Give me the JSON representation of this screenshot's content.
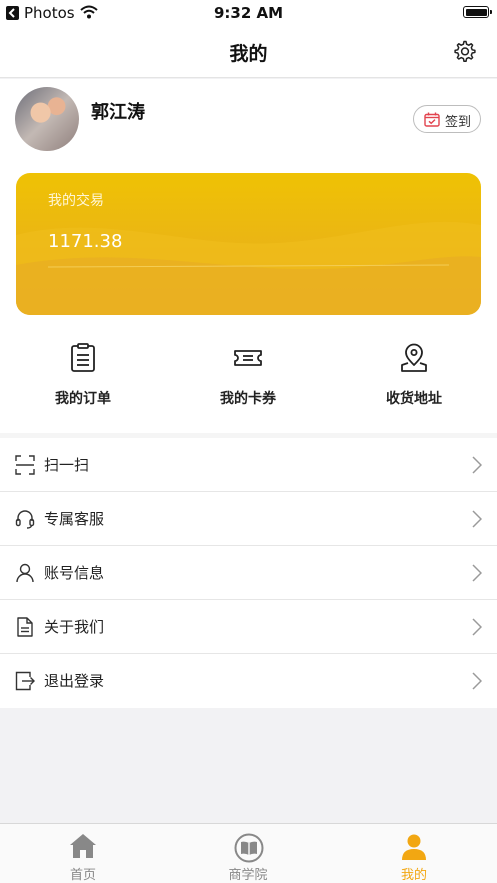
{
  "status_bar": {
    "app": "Photos",
    "time": "9:32 AM"
  },
  "nav": {
    "title": "我的",
    "settings_icon": "gear-icon"
  },
  "profile": {
    "name": "郭江涛",
    "checkin_label": "签到"
  },
  "card": {
    "label": "我的交易",
    "value": "1171.38"
  },
  "shortcuts": [
    {
      "label": "我的订单",
      "icon": "order-icon"
    },
    {
      "label": "我的卡券",
      "icon": "coupon-icon"
    },
    {
      "label": "收货地址",
      "icon": "address-icon"
    }
  ],
  "menu": [
    {
      "label": "扫一扫",
      "icon": "scan-icon"
    },
    {
      "label": "专属客服",
      "icon": "headset-icon"
    },
    {
      "label": "账号信息",
      "icon": "user-icon"
    },
    {
      "label": "关于我们",
      "icon": "document-icon"
    },
    {
      "label": "退出登录",
      "icon": "logout-icon"
    }
  ],
  "tabbar": [
    {
      "label": "首页",
      "icon": "home-icon",
      "active": false
    },
    {
      "label": "商学院",
      "icon": "book-icon",
      "active": false
    },
    {
      "label": "我的",
      "icon": "person-icon",
      "active": true
    }
  ],
  "colors": {
    "accent": "#f2a712",
    "card": "#ebb70f"
  }
}
